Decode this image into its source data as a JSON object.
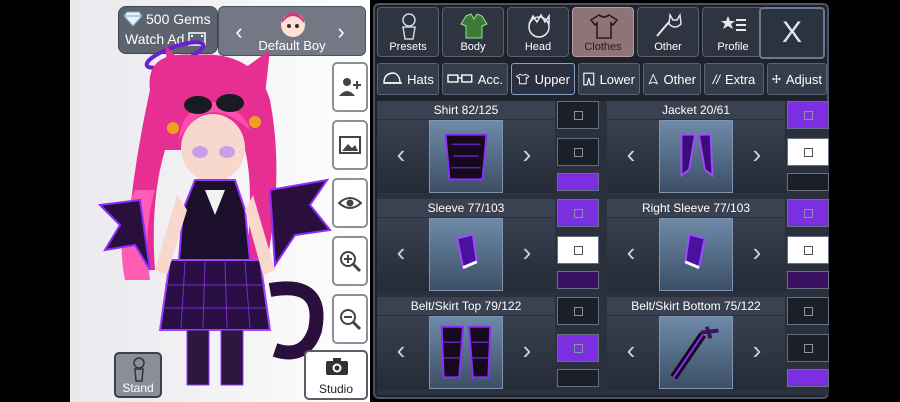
{
  "currency": {
    "gems_label": "500 Gems",
    "watch_ad_label": "Watch Ad"
  },
  "preset": {
    "name": "Default Boy"
  },
  "left_buttons": {
    "stand_label": "Stand",
    "studio_label": "Studio"
  },
  "categories": [
    {
      "label": "Presets",
      "icon": "person-icon"
    },
    {
      "label": "Body",
      "icon": "jacket-icon"
    },
    {
      "label": "Head",
      "icon": "head-icon"
    },
    {
      "label": "Clothes",
      "icon": "shirt-icon",
      "active": true
    },
    {
      "label": "Other",
      "icon": "sword-cat-icon"
    },
    {
      "label": "Profile",
      "icon": "star-list-icon"
    }
  ],
  "close_label": "X",
  "subtabs": [
    {
      "label": "Hats",
      "icon": "cap-icon"
    },
    {
      "label": "Acc.",
      "icon": "glasses-icon"
    },
    {
      "label": "Upper",
      "icon": "shirt-icon",
      "active": true
    },
    {
      "label": "Lower",
      "icon": "pants-icon"
    },
    {
      "label": "Other",
      "icon": "cape-icon"
    },
    {
      "label": "Extra",
      "icon": "slashes-icon"
    },
    {
      "label": "Adjust",
      "icon": "move-icon"
    }
  ],
  "items": [
    {
      "title": "Shirt 82/125",
      "swatches": [
        "#1b1f27",
        "#1b1f27",
        "#7b2fe0"
      ]
    },
    {
      "title": "Jacket 20/61",
      "swatches": [
        "#7b2fe0",
        "#ffffff",
        "#1b1f27"
      ]
    },
    {
      "title": "Sleeve 77/103",
      "swatches": [
        "#7b2fe0",
        "#ffffff",
        "#3a1060"
      ]
    },
    {
      "title": "Right Sleeve 77/103",
      "swatches": [
        "#7b2fe0",
        "#ffffff",
        "#3a1060"
      ]
    },
    {
      "title": "Belt/Skirt Top 79/122",
      "swatches": [
        "#1b1f27",
        "#7b2fe0",
        "#1b1f27"
      ]
    },
    {
      "title": "Belt/Skirt Bottom 75/122",
      "swatches": [
        "#1b1f27",
        "#1b1f27",
        "#7b2fe0"
      ]
    }
  ],
  "colors": {
    "accent_purple": "#7b2fe0",
    "active_category": "#8e7478",
    "panel_bg": "#1e222a"
  }
}
